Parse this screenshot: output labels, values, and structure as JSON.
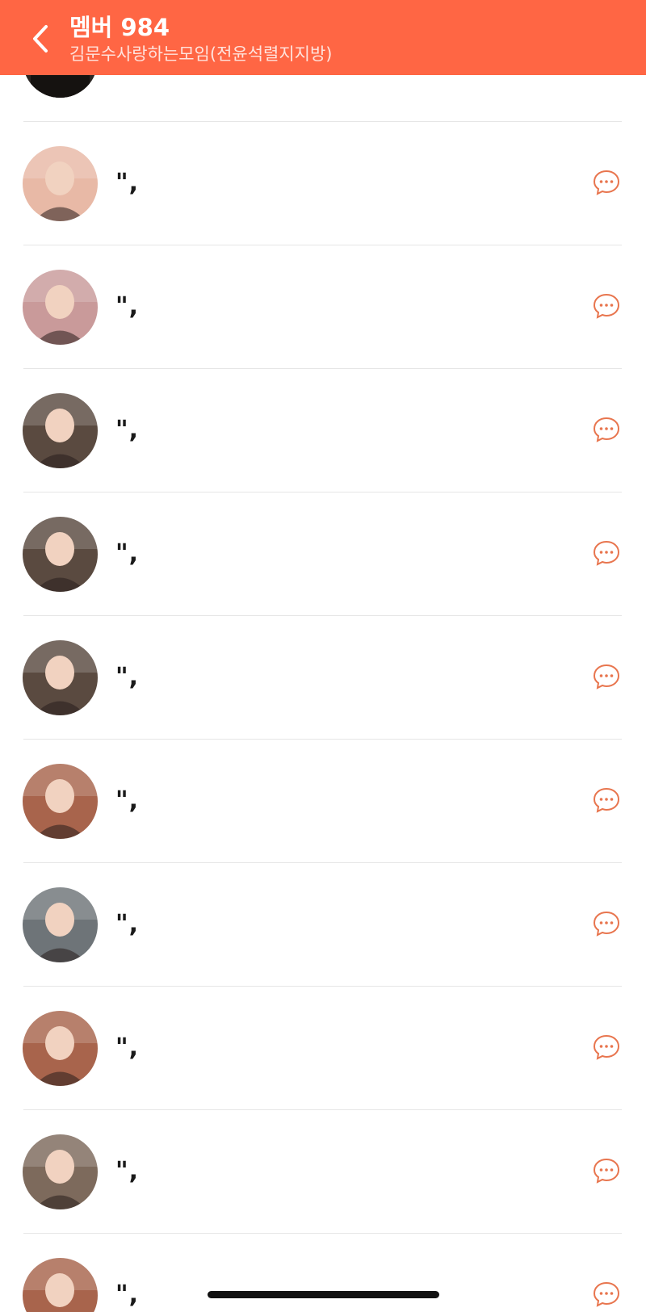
{
  "header": {
    "title": "멤버 984",
    "subtitle": "김문수사랑하는모임(전윤석렬지지방)"
  },
  "accent_color": "#FF6644",
  "icons": {
    "back": "chevron-left-icon",
    "chat": "chat-bubble-icon"
  },
  "members": [
    {
      "name": "\",",
      "avatar": "#e8b9a6"
    },
    {
      "name": "\",",
      "avatar": "#c99a9a"
    },
    {
      "name": "\",",
      "avatar": "#5a4a40"
    },
    {
      "name": "\",",
      "avatar": "#5a4a40"
    },
    {
      "name": "\",",
      "avatar": "#5a4a40"
    },
    {
      "name": "\",",
      "avatar": "#a8644c"
    },
    {
      "name": "\",",
      "avatar": "#6e7478"
    },
    {
      "name": "\",",
      "avatar": "#a8644c"
    },
    {
      "name": "\",",
      "avatar": "#7d6a5c"
    },
    {
      "name": "\",",
      "avatar": "#a8644c"
    }
  ]
}
